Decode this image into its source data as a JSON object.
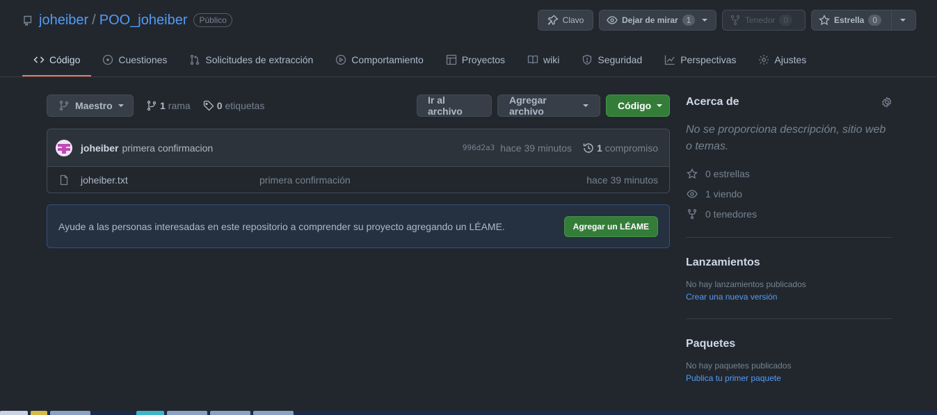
{
  "repo": {
    "owner": "joheiber",
    "separator": "/",
    "name": "POO_joheiber",
    "visibility": "Público"
  },
  "header_actions": {
    "pin_label": "Clavo",
    "watch_label": "Dejar de mirar",
    "watch_count": "1",
    "fork_label": "Tenedor",
    "fork_count": "0",
    "star_label": "Estrella",
    "star_count": "0"
  },
  "tabs": [
    {
      "label": "Código",
      "icon": "code-icon",
      "active": true
    },
    {
      "label": "Cuestiones",
      "icon": "issue-icon"
    },
    {
      "label": "Solicitudes de extracción",
      "icon": "pull-request-icon"
    },
    {
      "label": "Comportamiento",
      "icon": "play-icon"
    },
    {
      "label": "Proyectos",
      "icon": "table-icon"
    },
    {
      "label": "wiki",
      "icon": "book-icon"
    },
    {
      "label": "Seguridad",
      "icon": "shield-icon"
    },
    {
      "label": "Perspectivas",
      "icon": "graph-icon"
    },
    {
      "label": "Ajustes",
      "icon": "gear-icon"
    }
  ],
  "branch_bar": {
    "branch_name": "Maestro",
    "branch_count": "1",
    "branch_word": "rama",
    "tag_count": "0",
    "tag_word": "etiquetas",
    "goto_file": "Ir al archivo",
    "add_file": "Agregar archivo",
    "code_button": "Código"
  },
  "commit": {
    "author": "joheiber",
    "message": "primera confirmacion",
    "sha": "996d2a3",
    "age": "hace 39 minutos",
    "count": "1",
    "count_word": "compromiso"
  },
  "files": [
    {
      "name": "joheiber.txt",
      "message": "primera confirmación",
      "age": "hace 39 minutos"
    }
  ],
  "readme_prompt": {
    "text": "Ayude a las personas interesadas en este repositorio a comprender su proyecto agregando un LÉAME.",
    "button": "Agregar un LÉAME"
  },
  "sidebar": {
    "about_title": "Acerca de",
    "about_desc": "No se proporciona descripción, sitio web o temas.",
    "stars": "0 estrellas",
    "watching": "1 viendo",
    "forks": "0 tenedores",
    "releases_title": "Lanzamientos",
    "releases_note": "No hay lanzamientos publicados",
    "releases_link": "Crear una nueva versión",
    "packages_title": "Paquetes",
    "packages_note": "No hay paquetes publicados",
    "packages_link": "Publica tu primer paquete"
  },
  "colors": {
    "background": "#22272e",
    "link": "#539bf5",
    "primary_button": "#347d39",
    "active_tab_underline": "#ec775c"
  }
}
